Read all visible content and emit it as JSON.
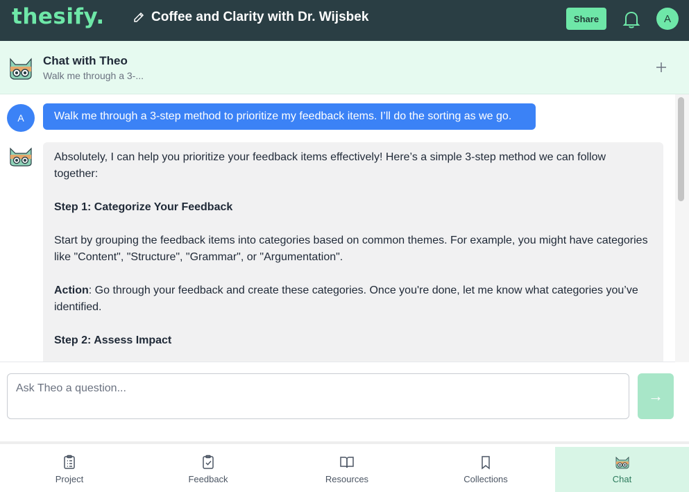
{
  "header": {
    "logo": "thesify.",
    "document_title": "Coffee and Clarity with Dr. Wijsbek",
    "share_label": "Share",
    "user_initial": "A"
  },
  "chat": {
    "title": "Chat with Theo",
    "subtitle": "Walk me through a 3-..."
  },
  "messages": {
    "user": {
      "initial": "A",
      "text": "Walk me through a 3-step method to prioritize my feedback items. I’ll do the sorting as we go."
    },
    "assistant": {
      "intro": "Absolutely, I can help you prioritize your feedback items effectively! Here’s a simple 3-step method we can follow together:",
      "step1_title": "Step 1: Categorize Your Feedback",
      "step1_body": "Start by grouping the feedback items into categories based on common themes. For example, you might have categories like \"Content\", \"Structure\", \"Grammar\", or \"Argumentation\".",
      "action_label": "Action",
      "action_body": ": Go through your feedback and create these categories. Once you're done, let me know what categories you’ve identified.",
      "step2_title": "Step 2: Assess Impact"
    }
  },
  "input": {
    "placeholder": "Ask Theo a question...",
    "send_icon": "→"
  },
  "nav": {
    "items": [
      {
        "label": "Project",
        "icon": "clipboard-list-icon"
      },
      {
        "label": "Feedback",
        "icon": "clipboard-check-icon"
      },
      {
        "label": "Resources",
        "icon": "book-open-icon"
      },
      {
        "label": "Collections",
        "icon": "bookmark-icon"
      },
      {
        "label": "Chat",
        "icon": "cat-icon",
        "active": true
      }
    ]
  },
  "colors": {
    "header_bg": "#2a3e44",
    "brand_green": "#6ee7a8",
    "user_bubble": "#3b82f6",
    "chat_header_bg": "#e6faf0",
    "active_nav_bg": "#d8f5e6"
  }
}
